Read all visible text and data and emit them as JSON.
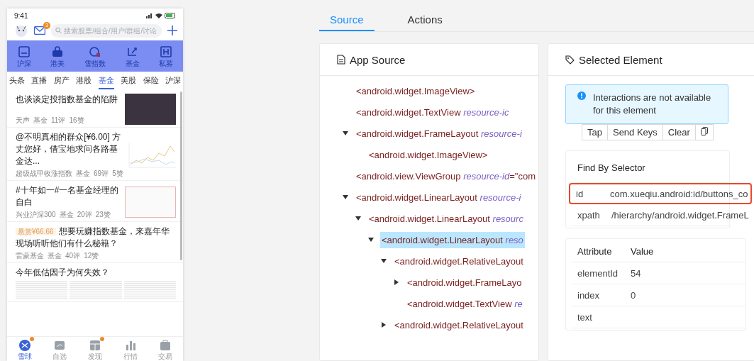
{
  "phone": {
    "status": {
      "time": "9:41"
    },
    "header": {
      "mail_badge": "3",
      "search_placeholder": "搜索股票/组合/用户/群组/讨论"
    },
    "shortcuts": [
      {
        "label": "沪深"
      },
      {
        "label": "港美"
      },
      {
        "label": "雪指数"
      },
      {
        "label": "基金"
      },
      {
        "label": "私募"
      }
    ],
    "channels": [
      {
        "label": "头条",
        "selected": false
      },
      {
        "label": "直播",
        "selected": false
      },
      {
        "label": "房产",
        "selected": false
      },
      {
        "label": "港股",
        "selected": false
      },
      {
        "label": "基金",
        "selected": true
      },
      {
        "label": "美股",
        "selected": false
      },
      {
        "label": "保险",
        "selected": false
      },
      {
        "label": "沪深",
        "selected": false
      }
    ],
    "feed": [
      {
        "kind": "photo",
        "title": "也谈谈定投指数基金的陷阱",
        "author": "天声",
        "tag": "基金",
        "comments": "11评",
        "likes": "16赞"
      },
      {
        "kind": "chart",
        "title": "@不明真相的群众[¥6.00] 方丈您好，借宝地求问各路基金达...",
        "author": "超级战甲收涨指数",
        "tag": "基金",
        "comments": "69评",
        "likes": "5赞"
      },
      {
        "kind": "document",
        "title": "#十年如一#一名基金经理的自白",
        "author": "兴业沪深300",
        "tag": "基金",
        "comments": "20评",
        "likes": "23赞"
      },
      {
        "kind": "text",
        "reward": "悬赏¥66.66",
        "title": "想要玩赚指数基金，来嘉年华现场听听他们有什么秘籍？",
        "author": "雷蒙基金",
        "tag": "基金",
        "comments": "40评",
        "likes": "12赞"
      },
      {
        "kind": "gallery",
        "title": "今年低估因子为何失效？"
      }
    ],
    "nav": [
      {
        "label": "雪球",
        "selected": true,
        "badge": true
      },
      {
        "label": "自选",
        "selected": false,
        "badge": false
      },
      {
        "label": "发现",
        "selected": false,
        "badge": true
      },
      {
        "label": "行情",
        "selected": false,
        "badge": false
      },
      {
        "label": "交易",
        "selected": false,
        "badge": false
      }
    ]
  },
  "tabs": [
    {
      "label": "Source",
      "selected": true
    },
    {
      "label": "Actions",
      "selected": false
    }
  ],
  "app_source": {
    "title": "App Source",
    "tree": [
      {
        "tag": "<android.widget.ImageView>",
        "selected": false
      },
      {
        "tag": "<android.widget.TextView",
        "attr": "resource-ic",
        "selected": false
      },
      {
        "tag": "<android.widget.FrameLayout",
        "attr": "resource-i",
        "selected": false,
        "expanded": true,
        "children": [
          {
            "tag": "<android.widget.ImageView>",
            "selected": false
          }
        ]
      },
      {
        "tag": "<android.view.ViewGroup",
        "attr": "resource-id",
        "value": "=\"com",
        "selected": false
      },
      {
        "tag": "<android.widget.LinearLayout",
        "attr": "resource-i",
        "selected": false,
        "expanded": true,
        "children": [
          {
            "tag": "<android.widget.LinearLayout",
            "attr": "resourc",
            "selected": false,
            "expanded": true,
            "children": [
              {
                "tag": "<android.widget.LinearLayout",
                "attr": "reso",
                "selected": true,
                "expanded": true,
                "children": [
                  {
                    "tag": "<android.widget.RelativeLayout",
                    "selected": false,
                    "expanded": true,
                    "children": [
                      {
                        "tag": "<android.widget.FrameLayo",
                        "selected": false,
                        "expanded": false
                      },
                      {
                        "tag": "<android.widget.TextView",
                        "attr": "re",
                        "selected": false
                      }
                    ]
                  },
                  {
                    "tag": "<android.widget.RelativeLayout",
                    "selected": false,
                    "expanded": false
                  }
                ]
              }
            ]
          }
        ]
      }
    ]
  },
  "selected_element": {
    "title": "Selected Element",
    "alert": "Interactions are not available for this element",
    "actions": [
      {
        "label": "Tap"
      },
      {
        "label": "Send Keys"
      },
      {
        "label": "Clear"
      }
    ],
    "selectors": {
      "columns": [
        "Find By",
        "Selector"
      ],
      "rows": [
        {
          "find_by": "id",
          "selector": "com.xueqiu.android:id/buttons_co",
          "highlighted": true
        },
        {
          "find_by": "xpath",
          "selector": "/hierarchy/android.widget.FrameL",
          "highlighted": false
        }
      ]
    },
    "attributes": {
      "columns": [
        "Attribute",
        "Value"
      ],
      "rows": [
        {
          "name": "elementId",
          "value": "54"
        },
        {
          "name": "index",
          "value": "0"
        },
        {
          "name": "text",
          "value": ""
        }
      ]
    }
  }
}
